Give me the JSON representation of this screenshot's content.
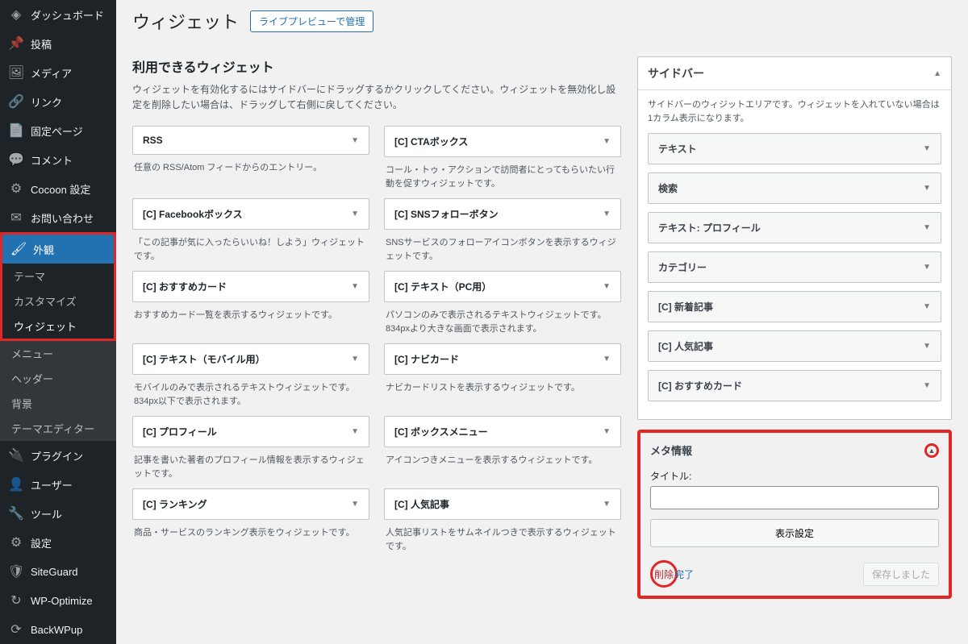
{
  "sidebar": {
    "items": [
      {
        "label": "ダッシュボード",
        "icon": "◈"
      },
      {
        "label": "投稿",
        "icon": "📌"
      },
      {
        "label": "メディア",
        "icon": "🖼"
      },
      {
        "label": "リンク",
        "icon": "🔗"
      },
      {
        "label": "固定ページ",
        "icon": "📄"
      },
      {
        "label": "コメント",
        "icon": "💬"
      },
      {
        "label": "Cocoon 設定",
        "icon": "⚙"
      },
      {
        "label": "お問い合わせ",
        "icon": "✉"
      },
      {
        "label": "外観",
        "icon": "🖌",
        "active": true
      },
      {
        "label": "プラグイン",
        "icon": "🔌"
      },
      {
        "label": "ユーザー",
        "icon": "👤"
      },
      {
        "label": "ツール",
        "icon": "🔧"
      },
      {
        "label": "設定",
        "icon": "⚙"
      },
      {
        "label": "SiteGuard",
        "icon": "🛡"
      },
      {
        "label": "WP-Optimize",
        "icon": "↻"
      },
      {
        "label": "BackWPup",
        "icon": "⟳"
      }
    ],
    "submenu": [
      {
        "label": "テーマ"
      },
      {
        "label": "カスタマイズ"
      },
      {
        "label": "ウィジェット",
        "current": true
      },
      {
        "label": "メニュー"
      },
      {
        "label": "ヘッダー"
      },
      {
        "label": "背景"
      },
      {
        "label": "テーマエディター"
      }
    ]
  },
  "page": {
    "title": "ウィジェット",
    "preview_btn": "ライブプレビューで管理"
  },
  "available": {
    "title": "利用できるウィジェット",
    "desc": "ウィジェットを有効化するにはサイドバーにドラッグするかクリックしてください。ウィジェットを無効化し設定を削除したい場合は、ドラッグして右側に戻してください。",
    "widgets": [
      {
        "name": "RSS",
        "desc": "任意の RSS/Atom フィードからのエントリー。"
      },
      {
        "name": "[C] CTAボックス",
        "desc": "コール・トゥ・アクションで訪問者にとってもらいたい行動を促すウィジェットです。"
      },
      {
        "name": "[C] Facebookボックス",
        "desc": "「この記事が気に入ったらいいね！しよう」ウィジェットです。"
      },
      {
        "name": "[C] SNSフォローボタン",
        "desc": "SNSサービスのフォローアイコンボタンを表示するウィジェットです。"
      },
      {
        "name": "[C] おすすめカード",
        "desc": "おすすめカード一覧を表示するウィジェットです。"
      },
      {
        "name": "[C] テキスト（PC用）",
        "desc": "パソコンのみで表示されるテキストウィジェットです。834pxより大きな画面で表示されます。"
      },
      {
        "name": "[C] テキスト（モバイル用）",
        "desc": "モバイルのみで表示されるテキストウィジェットです。834px以下で表示されます。"
      },
      {
        "name": "[C] ナビカード",
        "desc": "ナビカードリストを表示するウィジェットです。"
      },
      {
        "name": "[C] プロフィール",
        "desc": "記事を書いた著者のプロフィール情報を表示するウィジェットです。"
      },
      {
        "name": "[C] ボックスメニュー",
        "desc": "アイコンつきメニューを表示するウィジェットです。"
      },
      {
        "name": "[C] ランキング",
        "desc": "商品・サービスのランキング表示をウィジェットです。"
      },
      {
        "name": "[C] 人気記事",
        "desc": "人気記事リストをサムネイルつきで表示するウィジェットです。"
      }
    ]
  },
  "area": {
    "title": "サイドバー",
    "desc": "サイドバーのウィジットエリアです。ウィジェットを入れていない場合は1カラム表示になります。",
    "widgets": [
      {
        "name": "テキスト"
      },
      {
        "name": "検索"
      },
      {
        "name": "テキスト: プロフィール"
      },
      {
        "name": "カテゴリー"
      },
      {
        "name": "[C] 新着記事"
      },
      {
        "name": "[C] 人気記事"
      },
      {
        "name": "[C] おすすめカード"
      }
    ]
  },
  "meta_panel": {
    "title": "メタ情報",
    "title_label": "タイトル:",
    "display_settings": "表示設定",
    "delete": "削除",
    "done": "完了",
    "saved": "保存しました"
  }
}
